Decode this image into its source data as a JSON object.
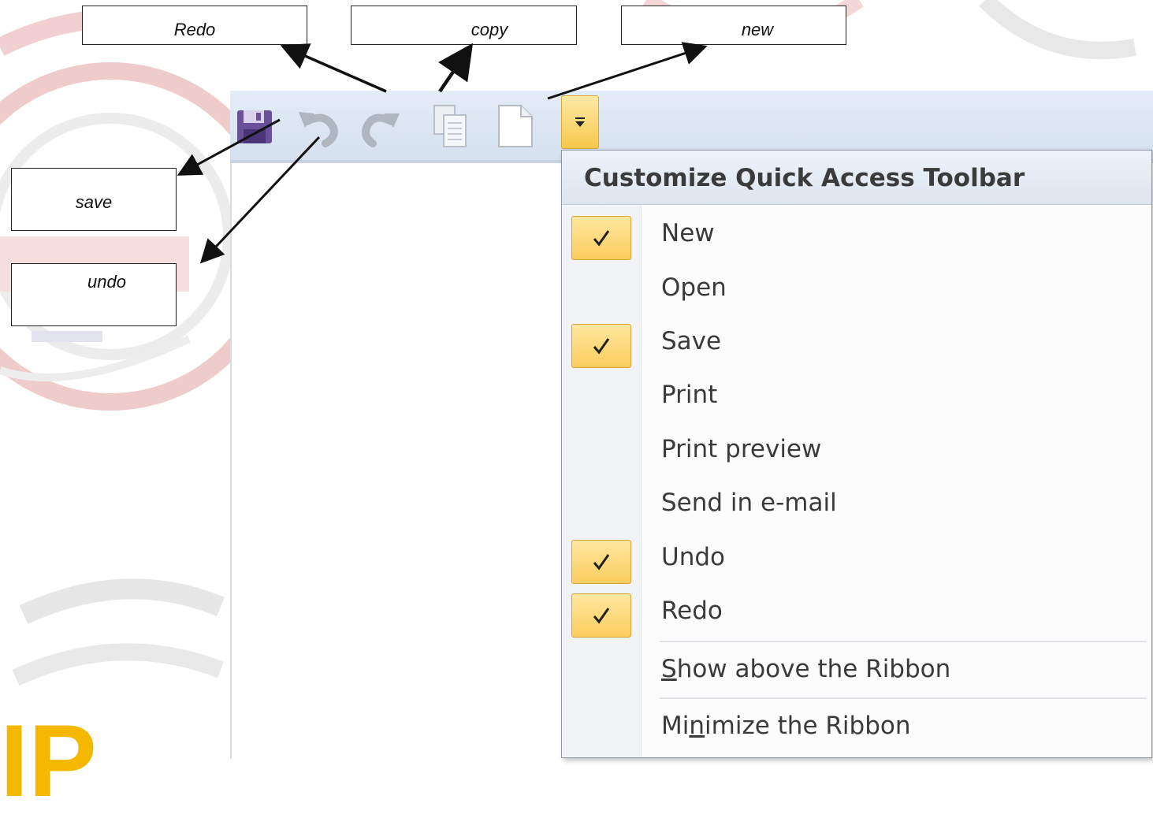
{
  "callouts": {
    "redo": "Redo",
    "copy": "copy",
    "new": "new",
    "save": "save",
    "undo": "undo"
  },
  "quick_access_toolbar": {
    "buttons": [
      {
        "id": "save",
        "icon": "save-icon"
      },
      {
        "id": "undo",
        "icon": "undo-icon"
      },
      {
        "id": "redo",
        "icon": "redo-icon"
      },
      {
        "id": "copy",
        "icon": "copy-icon"
      },
      {
        "id": "new",
        "icon": "new-document-icon"
      }
    ],
    "dropdown_icon": "chevron-down-icon"
  },
  "menu": {
    "title": "Customize Quick Access Toolbar",
    "items": [
      {
        "label": "New",
        "checked": true
      },
      {
        "label": "Open",
        "checked": false
      },
      {
        "label": "Save",
        "checked": true
      },
      {
        "label": "Print",
        "checked": false
      },
      {
        "label": "Print preview",
        "checked": false
      },
      {
        "label": "Send in e-mail",
        "checked": false
      },
      {
        "label": "Undo",
        "checked": true
      },
      {
        "label": "Redo",
        "checked": true
      }
    ],
    "show_above": {
      "prefix": "",
      "accel": "S",
      "rest": "how above the Ribbon"
    },
    "minimize": {
      "prefix": "Mi",
      "accel": "n",
      "rest": "imize the Ribbon"
    }
  },
  "colors": {
    "checkbox_fill": "#fbcd5e",
    "accent_orange": "#f5b800",
    "watermark_red": "#e9bfbf",
    "watermark_gray": "#e3e3e3"
  }
}
